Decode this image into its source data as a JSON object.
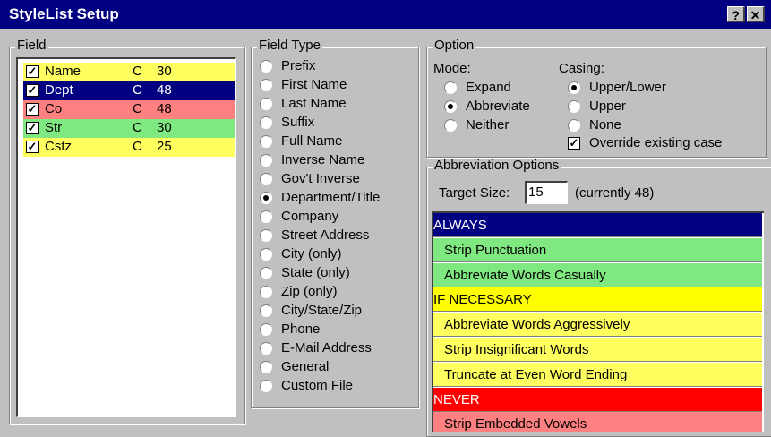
{
  "window": {
    "title": "StyleList Setup",
    "help_label": "?",
    "close_label": "✕",
    "help_icon": "question-icon",
    "close_icon": "close-icon"
  },
  "field_group": {
    "label": "Field",
    "items": [
      {
        "name": "Name",
        "type": "C",
        "size": "30",
        "checked": true,
        "bg": "#ffff60",
        "fg": "#000000"
      },
      {
        "name": "Dept",
        "type": "C",
        "size": "48",
        "checked": true,
        "bg": "#000080",
        "fg": "#ffffff"
      },
      {
        "name": "Co",
        "type": "C",
        "size": "48",
        "checked": true,
        "bg": "#ff8080",
        "fg": "#000000"
      },
      {
        "name": "Str",
        "type": "C",
        "size": "30",
        "checked": true,
        "bg": "#80e880",
        "fg": "#000000"
      },
      {
        "name": "Cstz",
        "type": "C",
        "size": "25",
        "checked": true,
        "bg": "#ffff60",
        "fg": "#000000"
      }
    ]
  },
  "field_type_group": {
    "label": "Field Type",
    "options": [
      {
        "label": "Prefix",
        "selected": false
      },
      {
        "label": "First Name",
        "selected": false
      },
      {
        "label": "Last Name",
        "selected": false
      },
      {
        "label": "Suffix",
        "selected": false
      },
      {
        "label": "Full Name",
        "selected": false
      },
      {
        "label": "Inverse Name",
        "selected": false
      },
      {
        "label": "Gov't Inverse",
        "selected": false
      },
      {
        "label": "Department/Title",
        "selected": true
      },
      {
        "label": "Company",
        "selected": false
      },
      {
        "label": "Street Address",
        "selected": false
      },
      {
        "label": "City (only)",
        "selected": false
      },
      {
        "label": "State (only)",
        "selected": false
      },
      {
        "label": "Zip (only)",
        "selected": false
      },
      {
        "label": "City/State/Zip",
        "selected": false
      },
      {
        "label": "Phone",
        "selected": false
      },
      {
        "label": "E-Mail Address",
        "selected": false
      },
      {
        "label": "General",
        "selected": false
      },
      {
        "label": "Custom File",
        "selected": false
      }
    ]
  },
  "option_group": {
    "label": "Option",
    "mode_label": "Mode:",
    "mode_options": [
      {
        "label": "Expand",
        "selected": false
      },
      {
        "label": "Abbreviate",
        "selected": true
      },
      {
        "label": "Neither",
        "selected": false
      }
    ],
    "casing_label": "Casing:",
    "casing_options": [
      {
        "label": "Upper/Lower",
        "selected": true
      },
      {
        "label": "Upper",
        "selected": false
      },
      {
        "label": "None",
        "selected": false
      }
    ],
    "override_label": "Override existing case",
    "override_checked": true
  },
  "abbreviation_group": {
    "label": "Abbreviation Options",
    "target_size_label": "Target Size:",
    "target_size_value": "15",
    "currently_text": "(currently 48)",
    "rows": [
      {
        "label": "ALWAYS",
        "kind": "header",
        "bg": "#000080",
        "fg": "#ffffff"
      },
      {
        "label": "Strip Punctuation",
        "kind": "item",
        "bg": "#80e880",
        "fg": "#000000"
      },
      {
        "label": "Abbreviate Words Casually",
        "kind": "item",
        "bg": "#80e880",
        "fg": "#000000"
      },
      {
        "label": "IF NECESSARY",
        "kind": "header",
        "bg": "#ffff00",
        "fg": "#000000"
      },
      {
        "label": "Abbreviate Words Aggressively",
        "kind": "item",
        "bg": "#ffff60",
        "fg": "#000000"
      },
      {
        "label": "Strip Insignificant Words",
        "kind": "item",
        "bg": "#ffff60",
        "fg": "#000000"
      },
      {
        "label": "Truncate at Even Word Ending",
        "kind": "item",
        "bg": "#ffff60",
        "fg": "#000000"
      },
      {
        "label": "NEVER",
        "kind": "header",
        "bg": "#ff0000",
        "fg": "#ffffff"
      },
      {
        "label": "Strip Embedded Vowels",
        "kind": "item",
        "bg": "#ff8080",
        "fg": "#000000"
      }
    ]
  }
}
